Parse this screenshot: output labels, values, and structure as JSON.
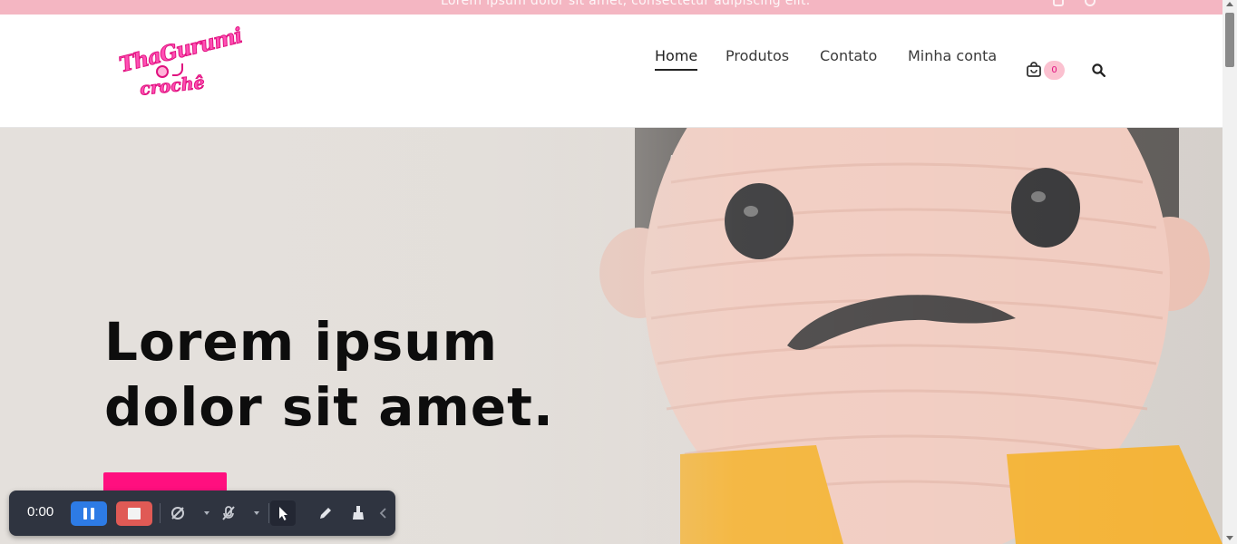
{
  "topbar": {
    "text": "Lorem ipsum dolor sit amet, consectetur adipiscing elit.",
    "icons": [
      "instagram-icon",
      "whatsapp-icon"
    ]
  },
  "logo": {
    "line1": "ThaGurumi",
    "line2": "crochê"
  },
  "nav": {
    "items": [
      {
        "label": "Home",
        "active": true
      },
      {
        "label": "Produtos",
        "active": false
      },
      {
        "label": "Contato",
        "active": false
      },
      {
        "label": "Minha conta",
        "active": false
      }
    ],
    "cart_count": "0",
    "cart_icon": "cart-icon",
    "search_icon": "search-icon"
  },
  "hero": {
    "title": "Lorem ipsum dolor sit amet.",
    "button_color": "#ff0f7f"
  },
  "recorder": {
    "time": "0:00",
    "pause_color": "#2d7be5",
    "stop_color": "#e05a55",
    "tools": [
      "camera-off-icon",
      "mic-off-icon",
      "pointer-icon",
      "pen-icon",
      "eraser-icon",
      "collapse-icon"
    ]
  },
  "colors": {
    "accent": "#ff0f7f",
    "topbar": "#f4b6c2",
    "badge": "#fbc1d0"
  }
}
